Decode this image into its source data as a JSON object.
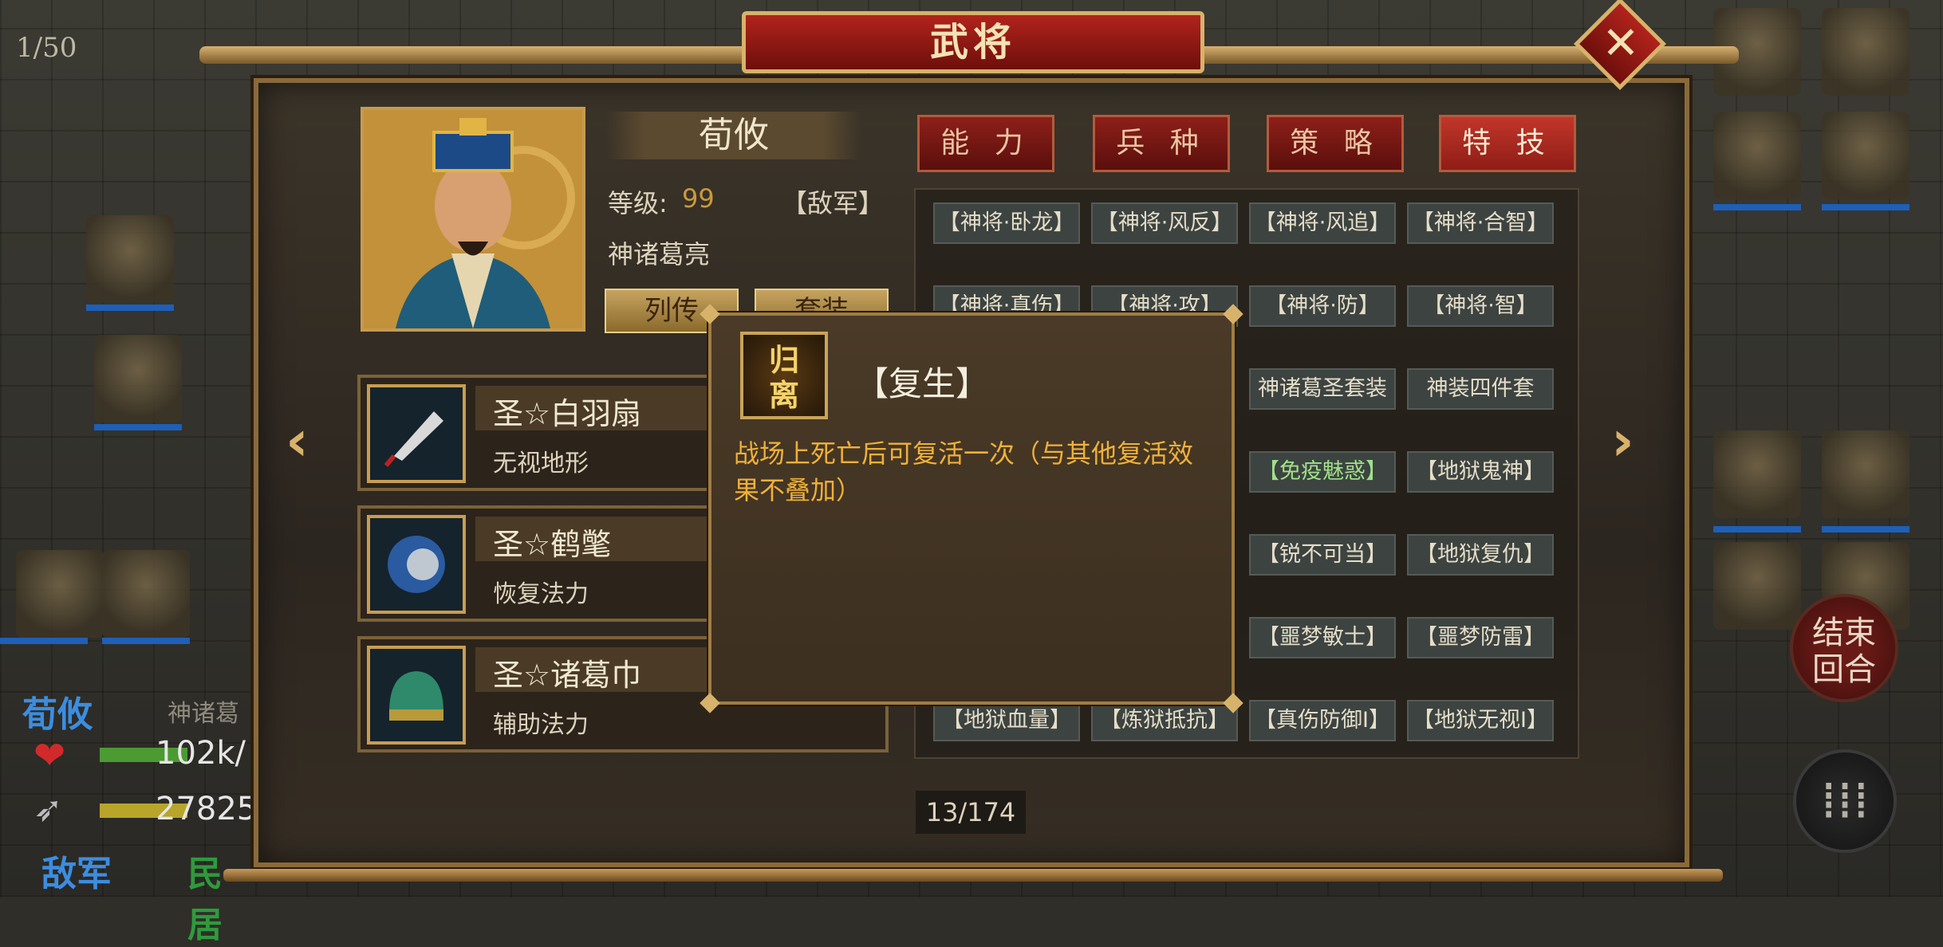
{
  "counter": "1/50",
  "dialog": {
    "title": "武将",
    "close_glyph": "✕"
  },
  "general": {
    "name": "荀攸",
    "level_label": "等级:",
    "level_value": "99",
    "faction": "【敌军】",
    "set_name": "神诸葛亮",
    "buttons": [
      "列传",
      "套装"
    ]
  },
  "equipment": [
    {
      "name": "圣☆白羽扇",
      "effect": "无视地形",
      "icon": "feather-fan-icon"
    },
    {
      "name": "圣☆鹤氅",
      "effect": "恢复法力",
      "icon": "cloak-icon"
    },
    {
      "name": "圣☆诸葛巾",
      "effect": "辅助法力",
      "icon": "headscarf-icon"
    }
  ],
  "tabs": [
    "能 力",
    "兵 种",
    "策 略",
    "特 技"
  ],
  "active_tab": 3,
  "skills": [
    [
      "【神将·卧龙】",
      "【神将·风反】",
      "【神将·风追】",
      "【神将·合智】"
    ],
    [
      "【神将·真伤】",
      "【神将·攻】",
      "【神将·防】",
      "【神将·智】"
    ],
    [
      "",
      "",
      "神诸葛圣套装",
      "神装四件套"
    ],
    [
      "",
      "",
      "【免疫魅惑】",
      "【地狱鬼神】"
    ],
    [
      "",
      "",
      "【锐不可当】",
      "【地狱复仇】"
    ],
    [
      "",
      "",
      "【噩梦敏士】",
      "【噩梦防雷】"
    ],
    [
      "【地狱血量】",
      "【炼狱抵抗】",
      "【真伤防御Ⅰ】",
      "【地狱无视Ⅰ】"
    ]
  ],
  "pager": "13/174",
  "tooltip": {
    "icon_text": "归离",
    "title": "【复生】",
    "description": "战场上死亡后可复活一次（与其他复活效果不叠加）"
  },
  "unit_info": {
    "name": "荀攸",
    "sub": "神诸葛",
    "hp": "102k/",
    "mp": "27825",
    "side": "敌军",
    "side2": "民居"
  },
  "end_turn": [
    "结束",
    "回合"
  ],
  "menu_glyph": "⁞⁞⁞",
  "colors": {
    "accent_gold": "#d7b26b",
    "tab_red": "#8e1f19",
    "tooltip_text": "#f0b13a"
  }
}
